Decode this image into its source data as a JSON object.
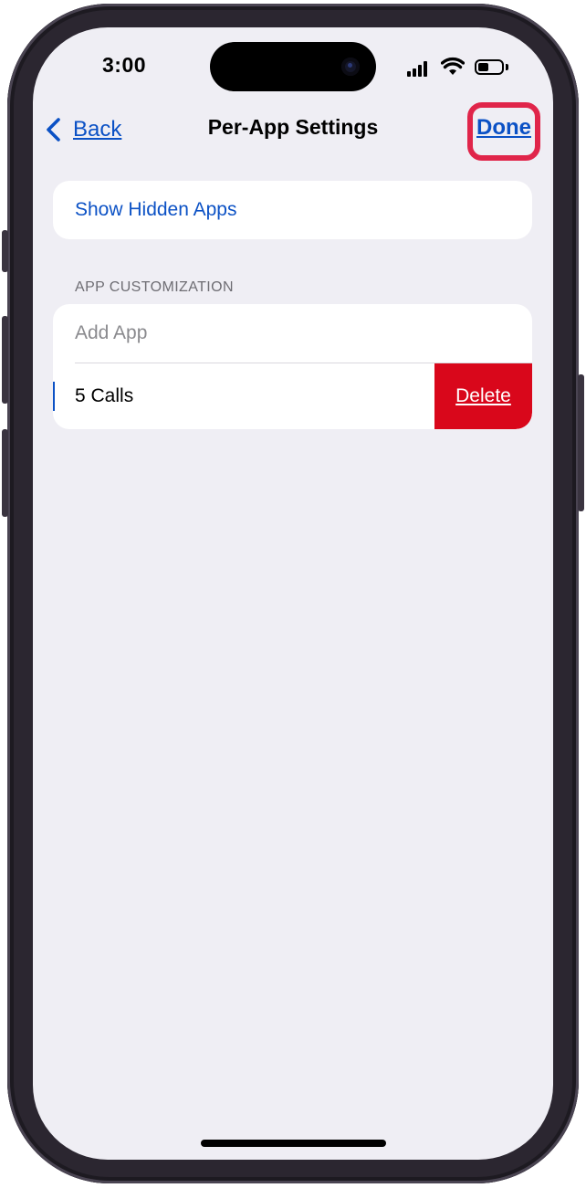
{
  "status_bar": {
    "time": "3:00",
    "icons": [
      "cellular-signal-icon",
      "wifi-icon",
      "battery-icon"
    ]
  },
  "nav": {
    "back_label": "Back",
    "title": "Per-App Settings",
    "done_label": "Done"
  },
  "show_hidden_apps": {
    "label": "Show Hidden Apps"
  },
  "app_customization": {
    "header": "APP CUSTOMIZATION",
    "add_app_label": "Add App",
    "apps": [
      {
        "name": "5 Calls",
        "delete_label": "Delete"
      }
    ]
  },
  "colors": {
    "accent": "#0b51c5",
    "delete": "#d9071b",
    "highlight_box": "#e0254a",
    "background": "#efeef4"
  }
}
